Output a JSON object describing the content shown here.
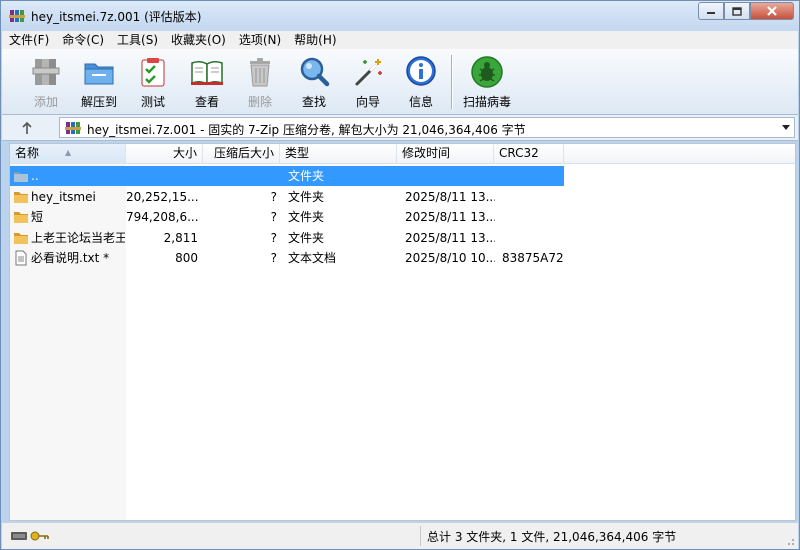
{
  "window": {
    "title": "hey_itsmei.7z.001 (评估版本)"
  },
  "menu": [
    "文件(F)",
    "命令(C)",
    "工具(S)",
    "收藏夹(O)",
    "选项(N)",
    "帮助(H)"
  ],
  "toolbar": {
    "add": "添加",
    "extract_to": "解压到",
    "test": "测试",
    "view": "查看",
    "delete": "删除",
    "find": "查找",
    "wizard": "向导",
    "info": "信息",
    "virus_scan": "扫描病毒"
  },
  "address": {
    "path": "hey_itsmei.7z.001 - 固实的 7-Zip 压缩分卷, 解包大小为 21,046,364,406 字节"
  },
  "columns": {
    "name": "名称",
    "size": "大小",
    "packed": "压缩后大小",
    "type": "类型",
    "modified": "修改时间",
    "crc": "CRC32"
  },
  "files": [
    {
      "name": "..",
      "size": "",
      "packed": "",
      "type": "文件夹",
      "modified": "",
      "crc": "",
      "icon": "parent-folder-icon",
      "selected": true
    },
    {
      "name": "hey_itsmei",
      "size": "20,252,15...",
      "packed": "?",
      "type": "文件夹",
      "modified": "2025/8/11 13...",
      "crc": "",
      "icon": "folder-icon",
      "selected": false
    },
    {
      "name": "短",
      "size": "794,208,6...",
      "packed": "?",
      "type": "文件夹",
      "modified": "2025/8/11 13...",
      "crc": "",
      "icon": "folder-icon",
      "selected": false
    },
    {
      "name": "上老王论坛当老王",
      "size": "2,811",
      "packed": "?",
      "type": "文件夹",
      "modified": "2025/8/11 13...",
      "crc": "",
      "icon": "folder-icon",
      "selected": false
    },
    {
      "name": "必看说明.txt *",
      "size": "800",
      "packed": "?",
      "type": "文本文档",
      "modified": "2025/8/10 10...",
      "crc": "83875A72",
      "icon": "text-file-icon",
      "selected": false
    }
  ],
  "status": {
    "summary": "总计 3 文件夹, 1 文件, 21,046,364,406 字节"
  },
  "colors": {
    "selection": "#3399ff",
    "window_frame": "#bcd3ee",
    "folder": "#e8b54a"
  }
}
